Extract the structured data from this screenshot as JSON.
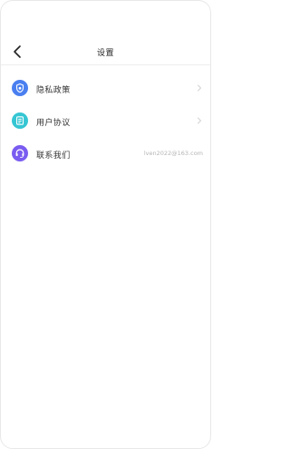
{
  "header": {
    "back_icon": "chevron-left-icon",
    "title": "设置"
  },
  "settings": [
    {
      "label": "隐私政策",
      "icon": "privacy-shield-icon",
      "icon_color": "#4a7ff0",
      "trailing": "chevron-right-icon"
    },
    {
      "label": "用户协议",
      "icon": "user-agreement-icon",
      "icon_color": "#36c6d3",
      "trailing": "chevron-right-icon"
    },
    {
      "label": "联系我们",
      "icon": "contact-headset-icon",
      "icon_color": "#7a5cf0",
      "value": "lven2022@163.com"
    }
  ]
}
